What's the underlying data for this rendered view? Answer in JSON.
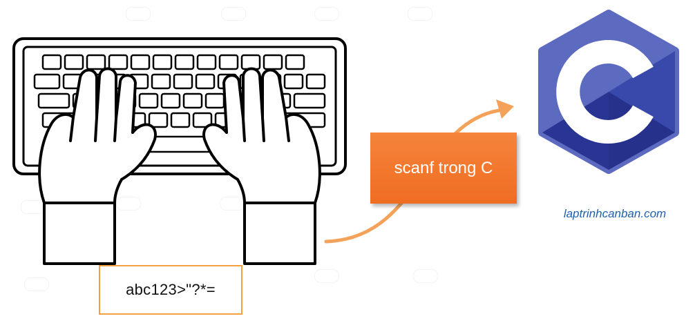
{
  "input_example": "abc123>\"?*=",
  "function_label": "scanf trong C",
  "logo_letter": "C",
  "website": "laptrinhcanban.com",
  "icons": {
    "keyboard": "keyboard-hands-icon",
    "arrow": "curved-arrow-icon",
    "logo": "c-language-logo-icon"
  },
  "colors": {
    "accent_orange": "#f07a2a",
    "input_border": "#f2a040",
    "logo_blue": "#5c6bc0",
    "logo_dark_blue": "#283593",
    "link_blue": "#1f5fae"
  }
}
